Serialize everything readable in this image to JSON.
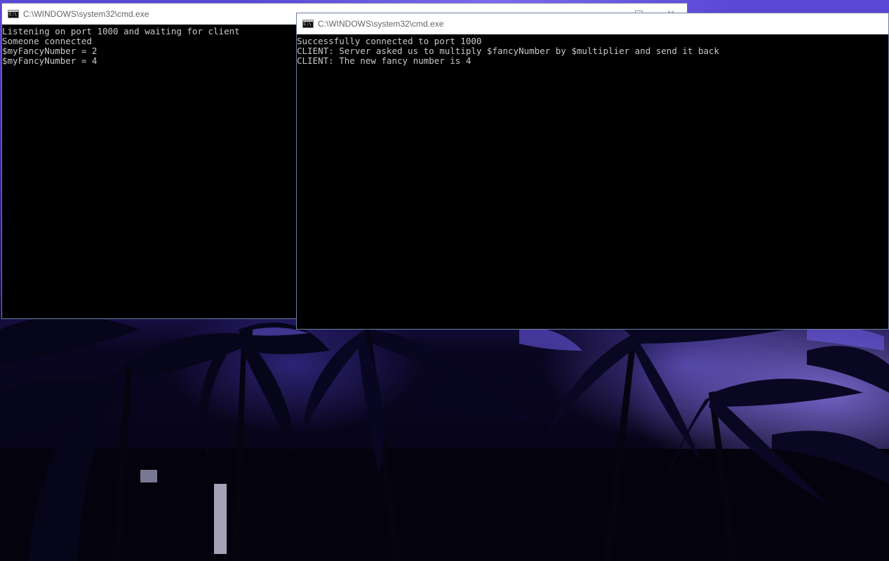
{
  "desktop": {
    "wallpaper": "tropical-palm-trees-at-dusk",
    "colors": {
      "sky": "#5b48d8",
      "silhouette": "#05030f"
    }
  },
  "window_left": {
    "title": "C:\\WINDOWS\\system32\\cmd.exe",
    "icon": "cmd-icon",
    "lines": [
      "Listening on port 1000 and waiting for client",
      "Someone connected",
      "$myFancyNumber = 2",
      "$myFancyNumber = 4"
    ]
  },
  "window_right": {
    "title": "C:\\WINDOWS\\system32\\cmd.exe",
    "icon": "cmd-icon",
    "lines": [
      "Successfully connected to port 1000",
      "CLIENT: Server asked us to multiply $fancyNumber by $multiplier and send it back",
      "CLIENT: The new fancy number is 4"
    ]
  },
  "controls": {
    "minimize": "minimize-icon",
    "maximize": "maximize-icon",
    "close": "close-icon"
  },
  "colors": {
    "console_bg": "#000000",
    "console_text": "#c8c8c8",
    "titlebar_bg": "#ffffff",
    "titlebar_text": "#666666"
  }
}
